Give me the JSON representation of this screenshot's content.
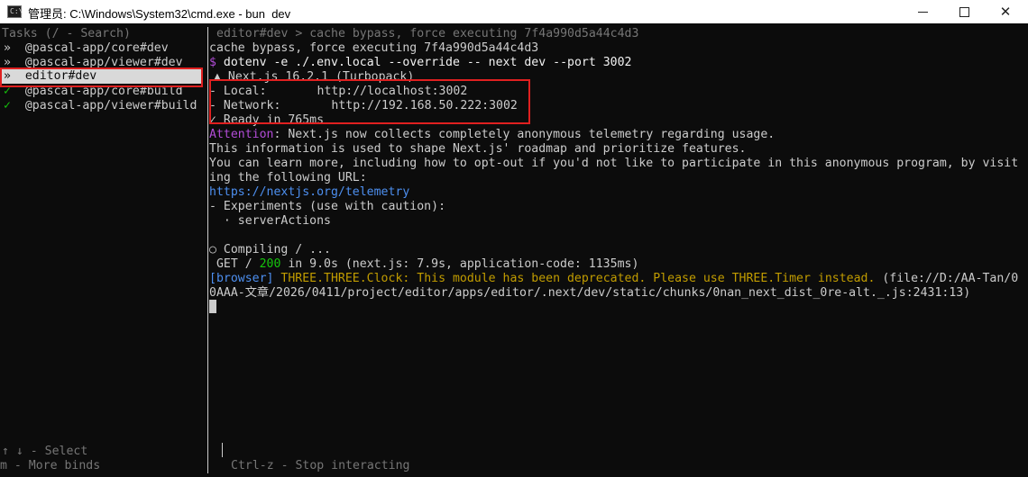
{
  "window": {
    "title": "管理员: C:\\Windows\\System32\\cmd.exe - bun  dev",
    "app_icon_text": "C:\\",
    "minimize_icon": "minimize-icon",
    "maximize_icon": "maximize-icon",
    "close_icon": "close-icon",
    "close_glyph": "✕"
  },
  "tasks": {
    "header": "Tasks (/ - Search)",
    "items": [
      {
        "marker": "»",
        "label": "@pascal-app/core#dev"
      },
      {
        "marker": "»",
        "label": "@pascal-app/viewer#dev"
      },
      {
        "marker": "»",
        "label": "editor#dev"
      },
      {
        "marker": "✓",
        "label": "@pascal-app/core#build"
      },
      {
        "marker": "✓",
        "label": "@pascal-app/viewer#build"
      }
    ],
    "footer_select": "↑ ↓ - Select",
    "footer_more": "m - More binds"
  },
  "terminal": {
    "header": "editor#dev > cache bypass, force executing 7f4a990d5a44c4d3",
    "cache_line": "cache bypass, force executing 7f4a990d5a44c4d3",
    "prompt_symbol": "$",
    "command": "dotenv -e ./.env.local --override -- next dev --port 3002",
    "next_version": "▲ Next.js 16.2.1 (Turbopack)",
    "local_label": "- Local:",
    "local_url": "http://localhost:3002",
    "network_label": "- Network:",
    "network_url": "http://192.168.50.222:3002",
    "ready": "✓ Ready in 765ms",
    "attention_label": "Attention",
    "attention_text": ": Next.js now collects completely anonymous telemetry regarding usage.",
    "info_line": "This information is used to shape Next.js' roadmap and prioritize features.",
    "learn_line_1": "You can learn more, including how to opt-out if you'd not like to participate in this anonymous program, by visit",
    "learn_line_2": "ing the following URL:",
    "telemetry_url": "https://nextjs.org/telemetry",
    "experiments": "- Experiments (use with caution):",
    "server_actions": "  · serverActions",
    "compiling": "○ Compiling / ...",
    "get_prefix": " GET / ",
    "get_status": "200",
    "get_suffix": " in 9.0s (next.js: 7.9s, application-code: 1135ms)",
    "browser_tag": "[browser]",
    "warning_text": " THREE.THREE.Clock: This module has been deprecated. Please use THREE.Timer instead.",
    "file_path_1": " (file://D:/AA-Tan/0",
    "file_path_2": "0AAA-文章/2026/0411/project/editor/apps/editor/.next/dev/static/chunks/0nan_next_dist_0re-alt._.js:2431:13)",
    "interact_hint": "Ctrl-z - Stop interacting"
  },
  "colors": {
    "background": "#0c0c0c",
    "text": "#cccccc",
    "dim": "#767676",
    "link_blue": "#4d8ff0",
    "attention_purple": "#b14cd6",
    "warning_orange": "#c19c00",
    "status_green": "#16c60c",
    "highlight_red": "#e02020",
    "selection_bg": "#d9d9d9"
  }
}
